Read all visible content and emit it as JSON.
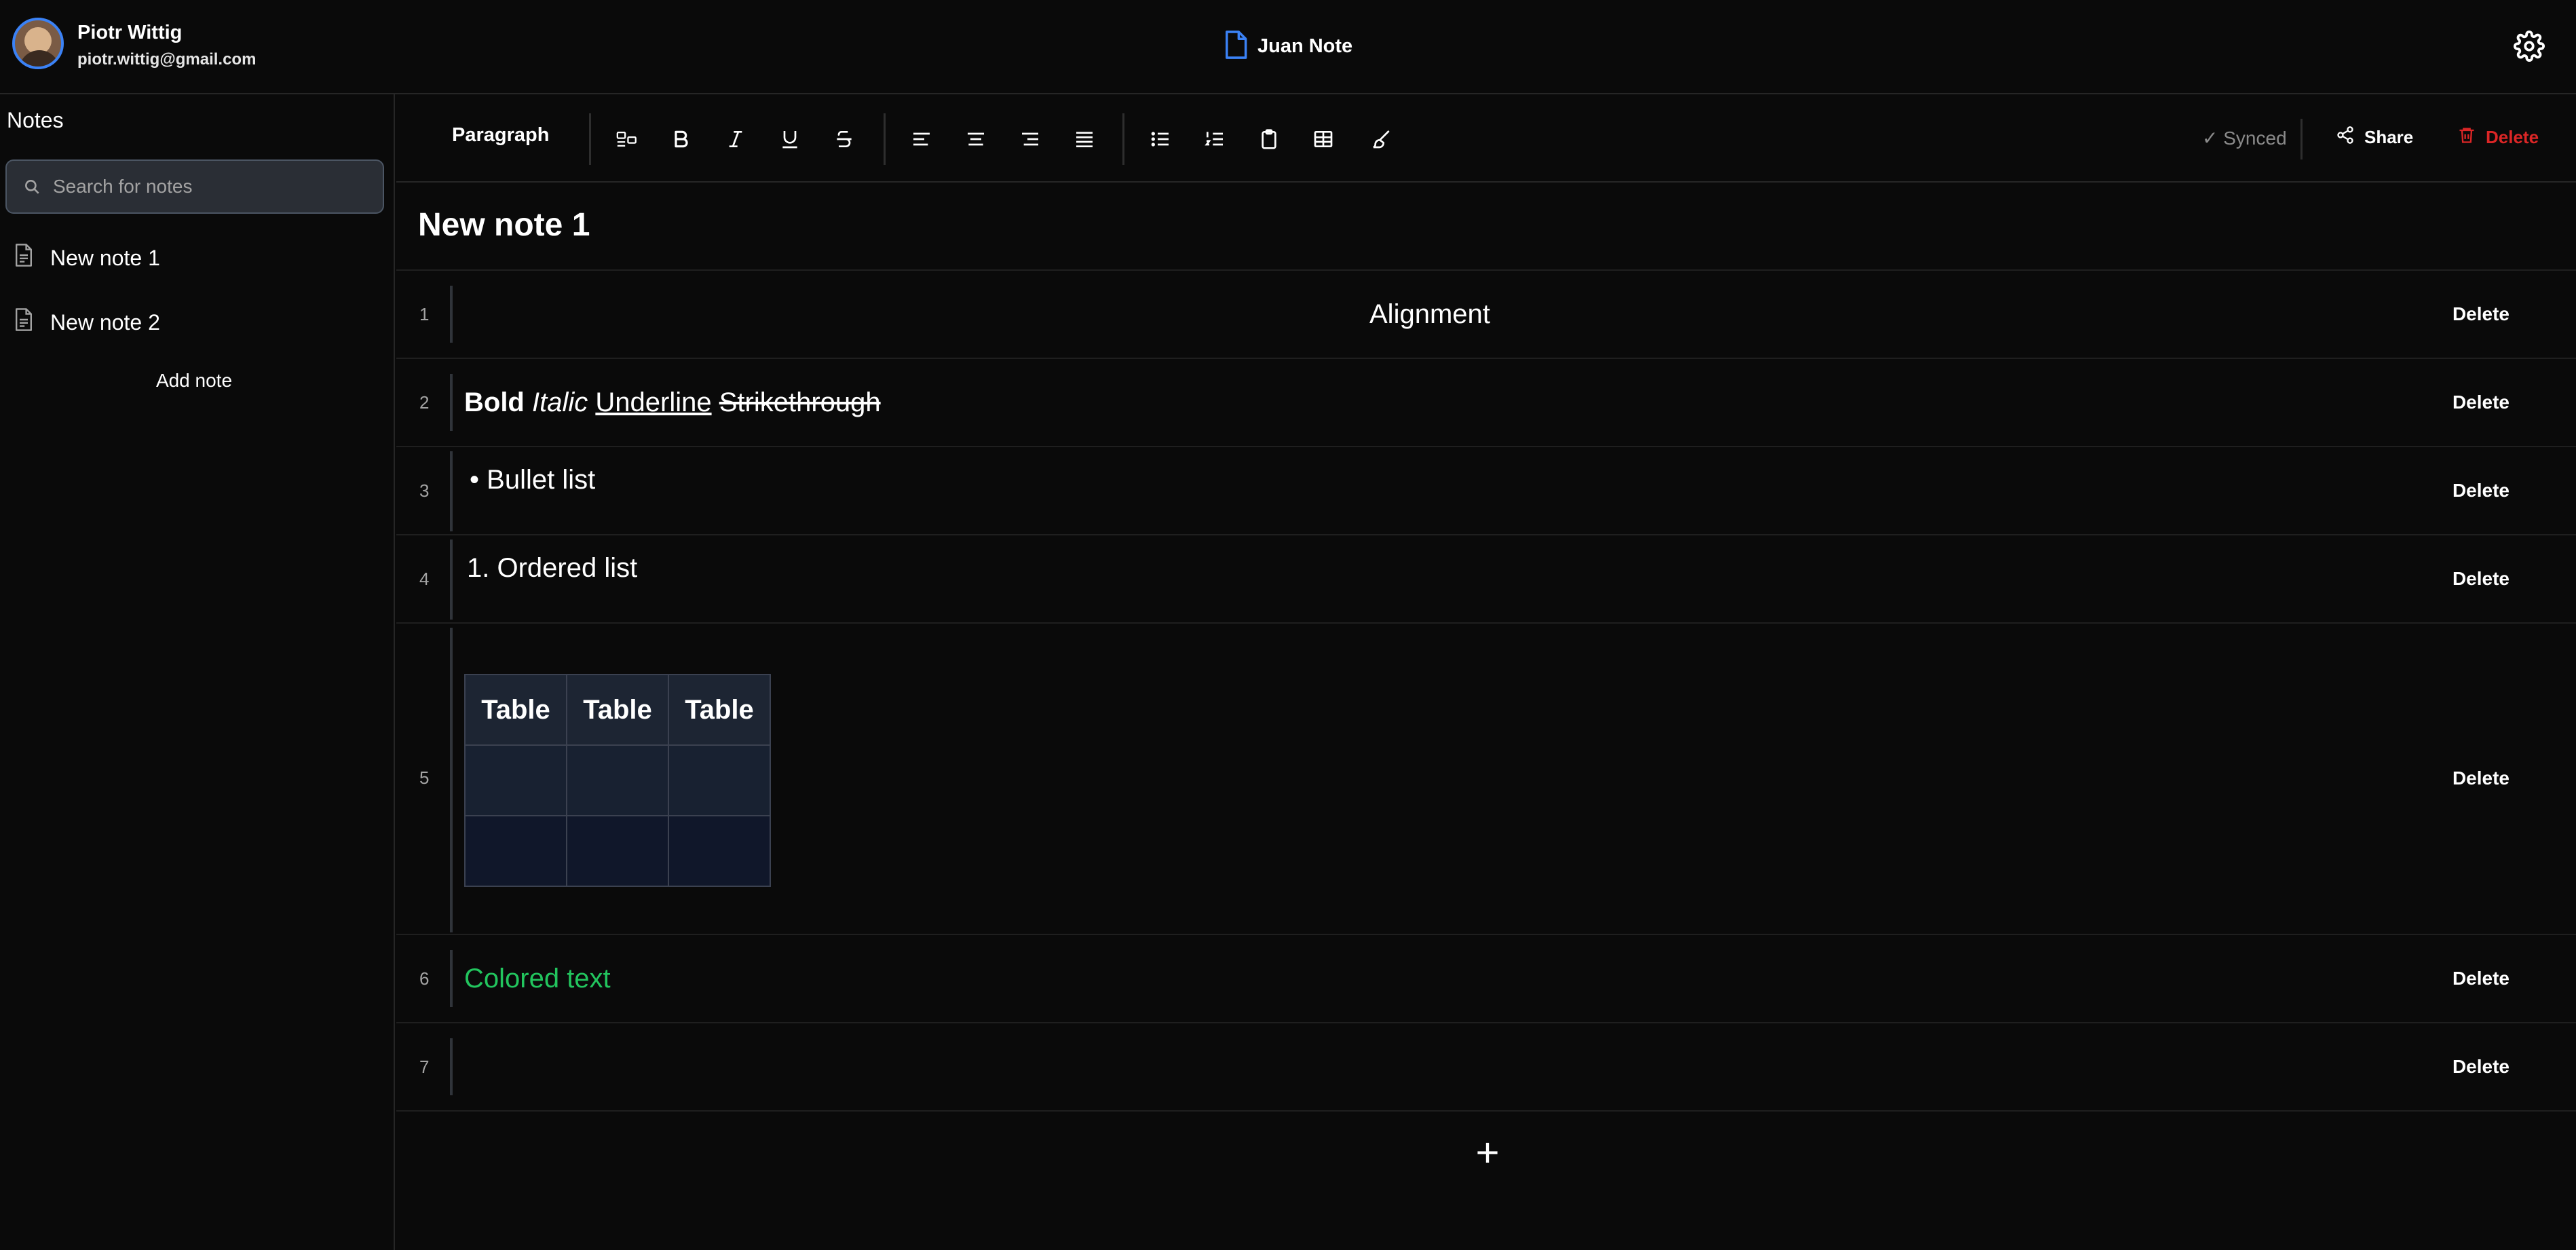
{
  "user": {
    "name": "Piotr Wittig",
    "email": "piotr.wittig@gmail.com"
  },
  "doc": {
    "title": "Juan Note"
  },
  "sidebar": {
    "title": "Notes",
    "search_placeholder": "Search for notes",
    "items": [
      {
        "label": "New note 1"
      },
      {
        "label": "New note 2"
      }
    ],
    "add_label": "Add note"
  },
  "toolbar": {
    "block_type": "Paragraph",
    "status": "Synced",
    "share_label": "Share",
    "delete_label": "Delete",
    "icons": [
      "block-style-icon",
      "bold-icon",
      "italic-icon",
      "underline-icon",
      "strikethrough-icon",
      "align-left-icon",
      "align-center-icon",
      "align-right-icon",
      "align-justify-icon",
      "bullet-list-icon",
      "ordered-list-icon",
      "clipboard-icon",
      "table-icon",
      "brush-icon"
    ]
  },
  "note": {
    "title": "New note 1",
    "blocks": [
      {
        "num": "1",
        "delete": "Delete",
        "text": "Alignment"
      },
      {
        "num": "2",
        "delete": "Delete",
        "bold": "Bold",
        "italic": "Italic",
        "underline": "Underline",
        "strike": "Strikethrough"
      },
      {
        "num": "3",
        "delete": "Delete",
        "bullet": "•",
        "text": "Bullet list"
      },
      {
        "num": "4",
        "delete": "Delete",
        "text": "1. Ordered list"
      },
      {
        "num": "5",
        "delete": "Delete",
        "table": {
          "headers": [
            "Table",
            "Table",
            "Table"
          ]
        }
      },
      {
        "num": "6",
        "delete": "Delete",
        "text": "Colored text",
        "color": "#22c55e"
      },
      {
        "num": "7",
        "delete": "Delete"
      }
    ],
    "add_block": "+"
  },
  "colors": {
    "accent": "#3b82f6",
    "danger": "#dc2626",
    "green": "#22c55e",
    "background": "#0a0a0a"
  }
}
